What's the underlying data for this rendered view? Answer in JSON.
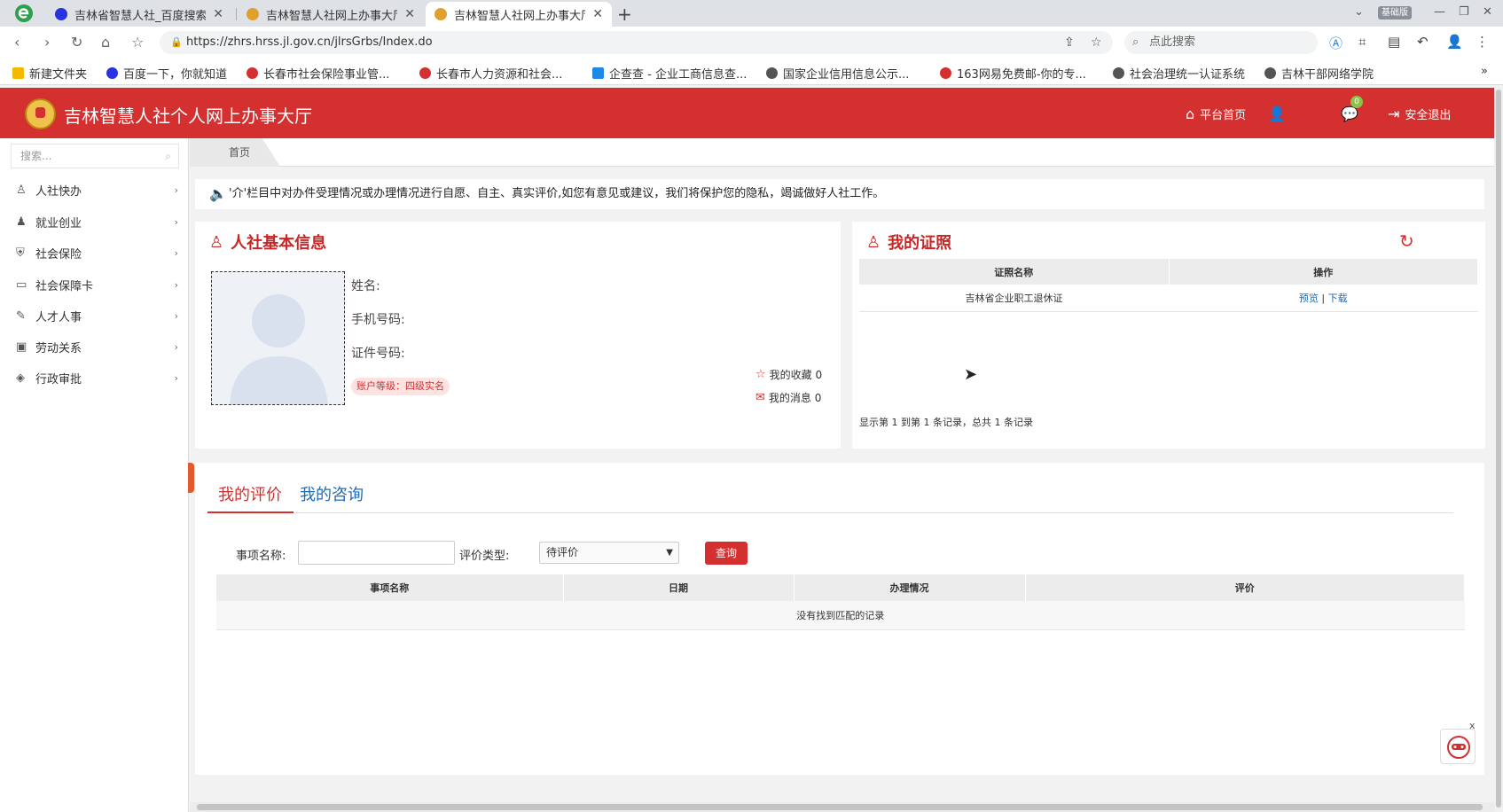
{
  "browser": {
    "tabs": [
      {
        "title": "吉林省智慧人社_百度搜索",
        "icon": "baidu-paw-icon"
      },
      {
        "title": "吉林智慧人社网上办事大厅",
        "icon": "emblem-icon"
      },
      {
        "title": "吉林智慧人社网上办事大厅",
        "icon": "emblem-icon"
      }
    ],
    "new_tab": "+",
    "version_badge": "基础版",
    "url": "https://zhrs.hrss.jl.gov.cn/jlrsGrbs/Index.do",
    "search_placeholder": "点此搜索",
    "bookmarks": [
      {
        "label": "新建文件夹",
        "color": "#f5b800"
      },
      {
        "label": "百度一下，你就知道",
        "color": "#2932e1"
      },
      {
        "label": "长春市社会保险事业管...",
        "color": "#d3302f"
      },
      {
        "label": "长春市人力资源和社会...",
        "color": "#d3302f"
      },
      {
        "label": "企查查 - 企业工商信息查...",
        "color": "#1e88e5"
      },
      {
        "label": "国家企业信用信息公示...",
        "color": "#555555"
      },
      {
        "label": "163网易免费邮-你的专...",
        "color": "#d3302f"
      },
      {
        "label": "社会治理统一认证系统",
        "color": "#555555"
      },
      {
        "label": "吉林干部网络学院",
        "color": "#555555"
      }
    ],
    "bookmarks_more": "»"
  },
  "app": {
    "title": "吉林智慧人社个人网上办事大厅",
    "brand_color": "#d3302f",
    "header": {
      "home_label": "平台首页",
      "message_count": "0",
      "logout_label": "安全退出"
    },
    "sidebar": {
      "search_placeholder": "搜索...",
      "items": [
        {
          "label": "人社快办",
          "icon": "user-icon"
        },
        {
          "label": "就业创业",
          "icon": "worker-icon"
        },
        {
          "label": "社会保险",
          "icon": "shield-icon"
        },
        {
          "label": "社会保障卡",
          "icon": "card-icon"
        },
        {
          "label": "人才人事",
          "icon": "talent-icon"
        },
        {
          "label": "劳动关系",
          "icon": "contract-icon"
        },
        {
          "label": "行政审批",
          "icon": "layers-icon"
        }
      ]
    },
    "breadcrumb": "首页",
    "notice": "'介'栏目中对办件受理情况或办理情况进行自愿、自主、真实评价,如您有意见或建议，我们将保护您的隐私，竭诚做好人社工作。",
    "basic_info": {
      "title": "人社基本信息",
      "name_label": "姓名:",
      "phone_label": "手机号码:",
      "id_label": "证件号码:",
      "account_level": "账户等级：四级实名",
      "favorites": "我的收藏 0",
      "messages": "我的消息 0"
    },
    "certificates": {
      "title": "我的证照",
      "columns": [
        "证照名称",
        "操作"
      ],
      "rows": [
        {
          "name": "吉林省企业职工退休证",
          "preview": "预览",
          "sep": "|",
          "download": "下载"
        }
      ],
      "footer": "显示第 1 到第 1 条记录，总共 1 条记录"
    },
    "evaluation": {
      "tabs": [
        "我的评价",
        "我的咨询"
      ],
      "item_name_label": "事项名称:",
      "type_label": "评价类型:",
      "type_value": "待评价",
      "query_button": "查询",
      "columns": [
        "事项名称",
        "日期",
        "办理情况",
        "评价"
      ],
      "empty_text": "没有找到匹配的记录"
    },
    "robot_close": "x"
  }
}
